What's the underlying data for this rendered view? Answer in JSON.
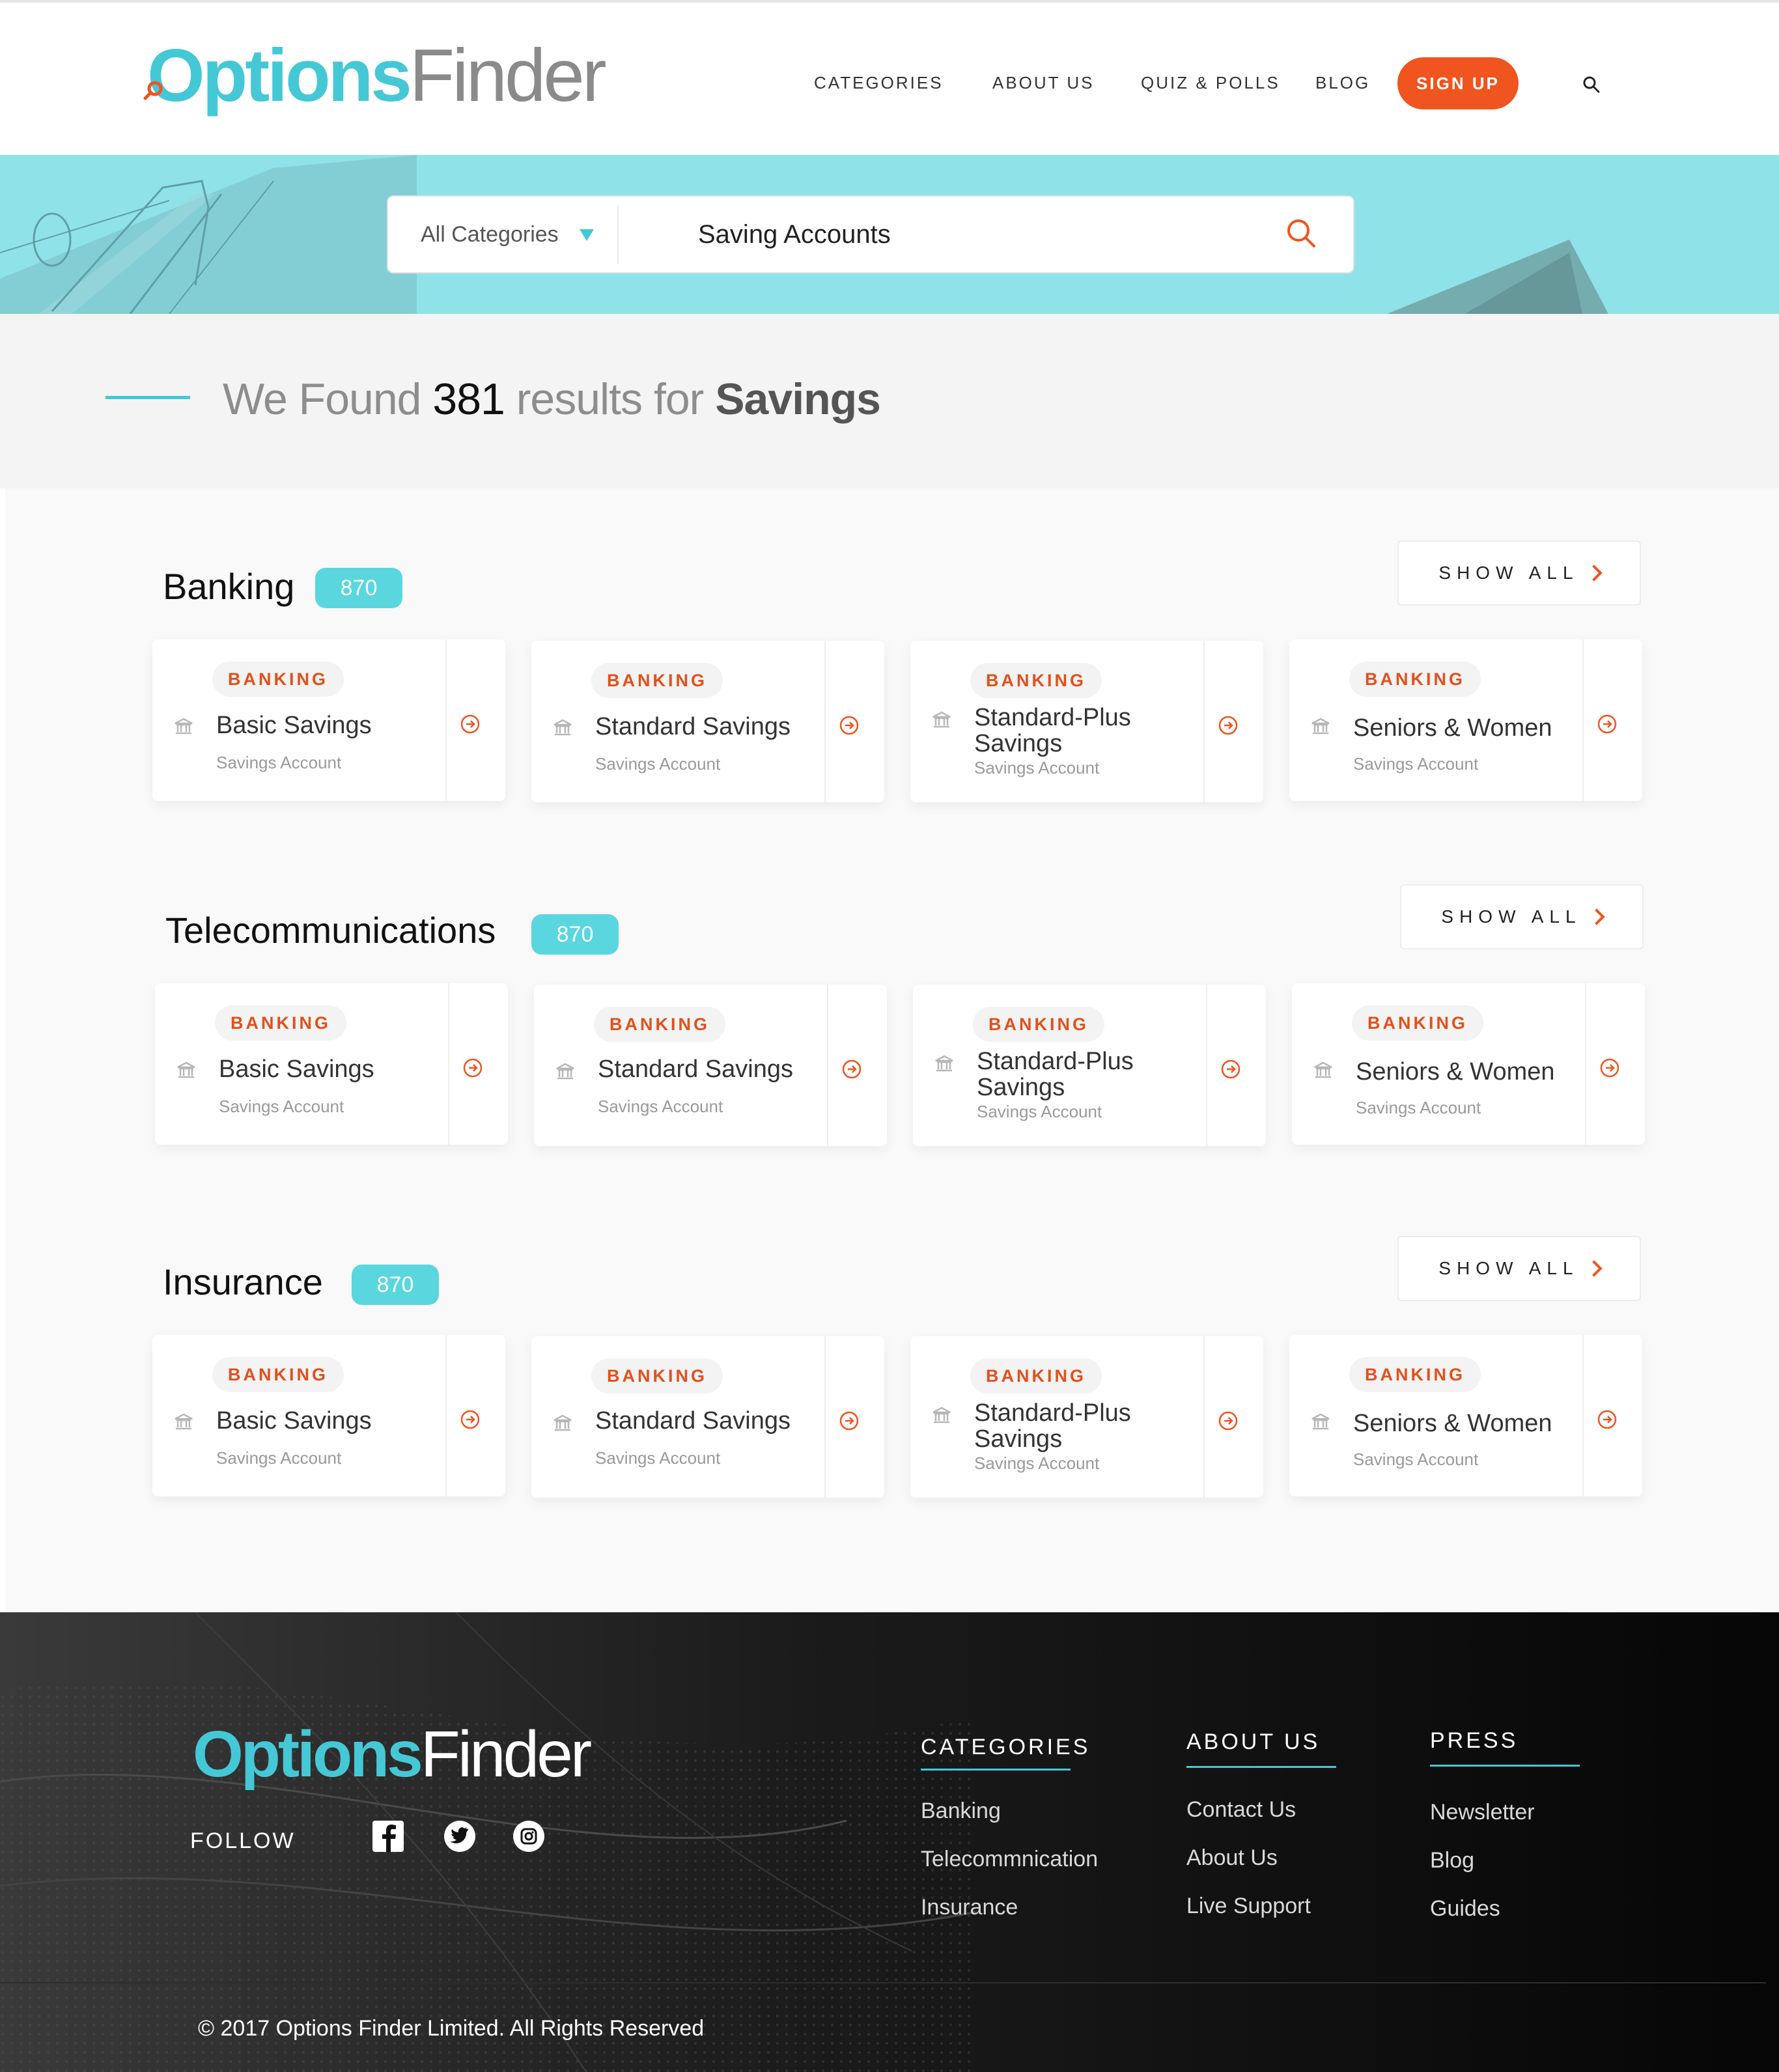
{
  "brand": {
    "logo_part1": "Options",
    "logo_part2": "Finder",
    "accent": "#45c8d6",
    "cta": "#f0541f"
  },
  "nav": {
    "items": [
      "CATEGORIES",
      "ABOUT US",
      "QUIZ & POLLS",
      "BLOG"
    ],
    "signup_label": "SIGN UP",
    "search_icon": "search-icon"
  },
  "search": {
    "category_label": "All Categories",
    "query_value": "Saving Accounts"
  },
  "results": {
    "prefix": "We Found",
    "count": "381",
    "middle": "results for",
    "query": "Savings"
  },
  "sections": [
    {
      "title": "Banking",
      "count": "870",
      "show_all": "SHOW ALL",
      "cards": [
        {
          "tag": "BANKING",
          "title": "Basic Savings",
          "subtitle": "Savings Account"
        },
        {
          "tag": "BANKING",
          "title": "Standard Savings",
          "subtitle": "Savings Account"
        },
        {
          "tag": "BANKING",
          "title": "Standard-Plus Savings",
          "subtitle": "Savings Account"
        },
        {
          "tag": "BANKING",
          "title": "Seniors & Women",
          "subtitle": "Savings Account"
        }
      ]
    },
    {
      "title": "Telecommunications",
      "count": "870",
      "show_all": "SHOW ALL",
      "cards": [
        {
          "tag": "BANKING",
          "title": "Basic Savings",
          "subtitle": "Savings Account"
        },
        {
          "tag": "BANKING",
          "title": "Standard Savings",
          "subtitle": "Savings Account"
        },
        {
          "tag": "BANKING",
          "title": "Standard-Plus Savings",
          "subtitle": "Savings Account"
        },
        {
          "tag": "BANKING",
          "title": "Seniors & Women",
          "subtitle": "Savings Account"
        }
      ]
    },
    {
      "title": "Insurance",
      "count": "870",
      "show_all": "SHOW ALL",
      "cards": [
        {
          "tag": "BANKING",
          "title": "Basic Savings",
          "subtitle": "Savings Account"
        },
        {
          "tag": "BANKING",
          "title": "Standard Savings",
          "subtitle": "Savings Account"
        },
        {
          "tag": "BANKING",
          "title": "Standard-Plus Savings",
          "subtitle": "Savings Account"
        },
        {
          "tag": "BANKING",
          "title": "Seniors & Women",
          "subtitle": "Savings Account"
        }
      ]
    }
  ],
  "footer": {
    "logo_part1": "Options",
    "logo_part2": "Finder",
    "follow_label": "FOLLOW",
    "social_icons": [
      "facebook-icon",
      "twitter-icon",
      "instagram-icon"
    ],
    "columns": [
      {
        "title": "CATEGORIES",
        "links": [
          "Banking",
          "Telecommnication",
          "Insurance"
        ]
      },
      {
        "title": "ABOUT US",
        "links": [
          "Contact Us",
          "About Us",
          "Live Support"
        ]
      },
      {
        "title": "PRESS",
        "links": [
          "Newsletter",
          "Blog",
          "Guides"
        ]
      }
    ],
    "copyright": "© 2017 Options Finder Limited. All Rights Reserved"
  }
}
